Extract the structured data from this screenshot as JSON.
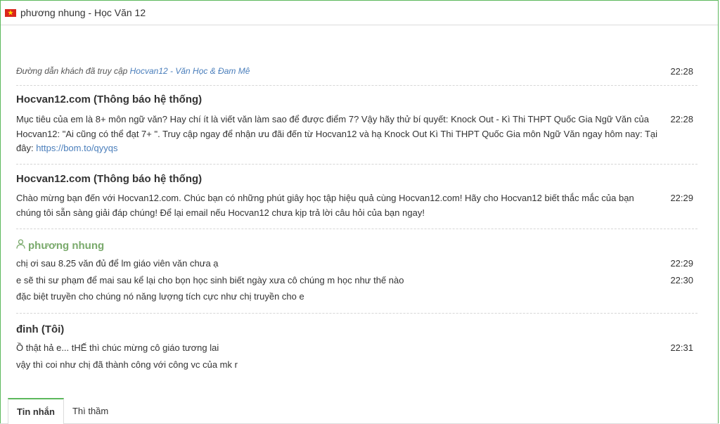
{
  "window": {
    "title": "phương nhung - Học Văn 12"
  },
  "visit": {
    "prefix": "Đường dẫn khách đã truy cập",
    "link": "Hocvan12 - Văn Học & Đam Mê",
    "time": "22:28"
  },
  "messages": [
    {
      "sender": "Hocvan12.com (Thông báo hệ thống)",
      "text_before": "Mục tiêu của em là 8+ môn ngữ văn? Hay chí ít là viết văn làm sao để được điểm 7? Vậy hãy thử bí quyết: Knock Out - Kì Thi THPT Quốc Gia Ngữ Văn của Hocvan12: \"Ai cũng có thể đạt 7+ \". Truy cập ngay để nhận ưu đãi đến từ Hocvan12 và hạ Knock Out Kì Thi THPT Quốc Gia môn Ngữ Văn ngay hôm nay: Tại đây: ",
      "link": "https://bom.to/qyyqs",
      "time": "22:28"
    },
    {
      "sender": "Hocvan12.com (Thông báo hệ thống)",
      "text": "Chào mừng bạn đến với Hocvan12.com. Chúc bạn có những phút giây học tập hiệu quả cùng Hocvan12.com! Hãy cho Hocvan12 biết thắc mắc của bạn chúng tôi sẵn sàng giải đáp chúng! Để lại email nếu Hocvan12 chưa kịp trả lời câu hỏi của bạn ngay!",
      "time": "22:29"
    }
  ],
  "guest": {
    "name": "phương nhung",
    "lines": [
      {
        "text": "chị ơi sau 8.25 văn đủ để lm giáo viên văn chưa ạ",
        "time": "22:29"
      },
      {
        "text": "e sẽ thi sư phạm để mai sau kể lại cho bọn học sinh biết ngày xưa cô chúng m học như thế nào",
        "time": "22:30"
      },
      {
        "text": "đặc biệt truyền cho chúng nó năng lượng tích cực như chị truyền cho e",
        "time": ""
      }
    ]
  },
  "self": {
    "name": "đinh (Tôi)",
    "lines": [
      {
        "text": "Ồ thật hả e... tHẾ thì chúc mừng cô giáo tương lai",
        "time": "22:31"
      },
      {
        "text": "vậy thì coi như chị đã thành công với công vc của mk r",
        "time": ""
      }
    ]
  },
  "tabs": [
    {
      "label": "Tin nhắn",
      "active": true
    },
    {
      "label": "Thì thầm",
      "active": false
    }
  ],
  "colors": {
    "accent": "#5cb85c",
    "link": "#4a7ebb",
    "guest_name": "#7aaa6c"
  }
}
